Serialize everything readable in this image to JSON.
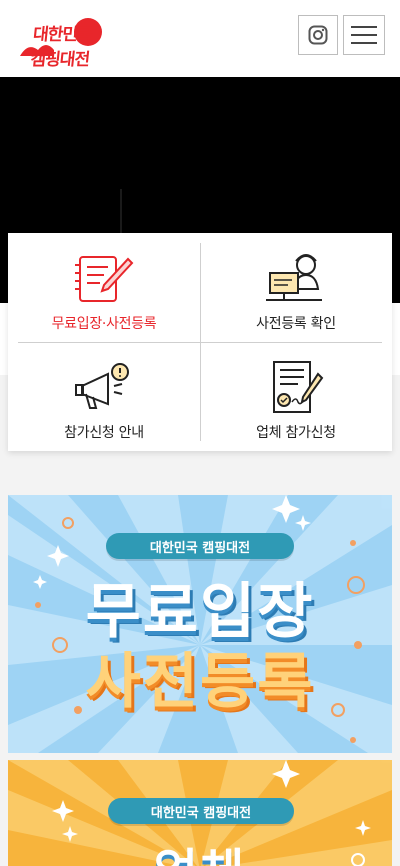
{
  "header": {
    "logo_text": "대한민국 캠핑대전",
    "instagram_icon": "instagram-icon",
    "menu_icon": "hamburger-menu-icon"
  },
  "quick_menu": {
    "items": [
      {
        "label": "무료입장·사전등록",
        "icon": "pencil-notepad-icon",
        "highlighted": true
      },
      {
        "label": "사전등록 확인",
        "icon": "person-computer-icon"
      },
      {
        "label": "참가신청 안내",
        "icon": "megaphone-icon"
      },
      {
        "label": "업체 참가신청",
        "icon": "contract-sign-icon"
      }
    ]
  },
  "banners": [
    {
      "pill": "대한민국 캠핑대전",
      "line1": "무료입장",
      "line2": "사전등록"
    },
    {
      "pill": "대한민국 캠핑대전",
      "line1": "업체"
    }
  ],
  "colors": {
    "brand_red": "#e8262b",
    "banner1_bg": "#9ed3f4",
    "banner2_bg": "#f7b43c",
    "pill_bg": "#2f9ab5"
  }
}
